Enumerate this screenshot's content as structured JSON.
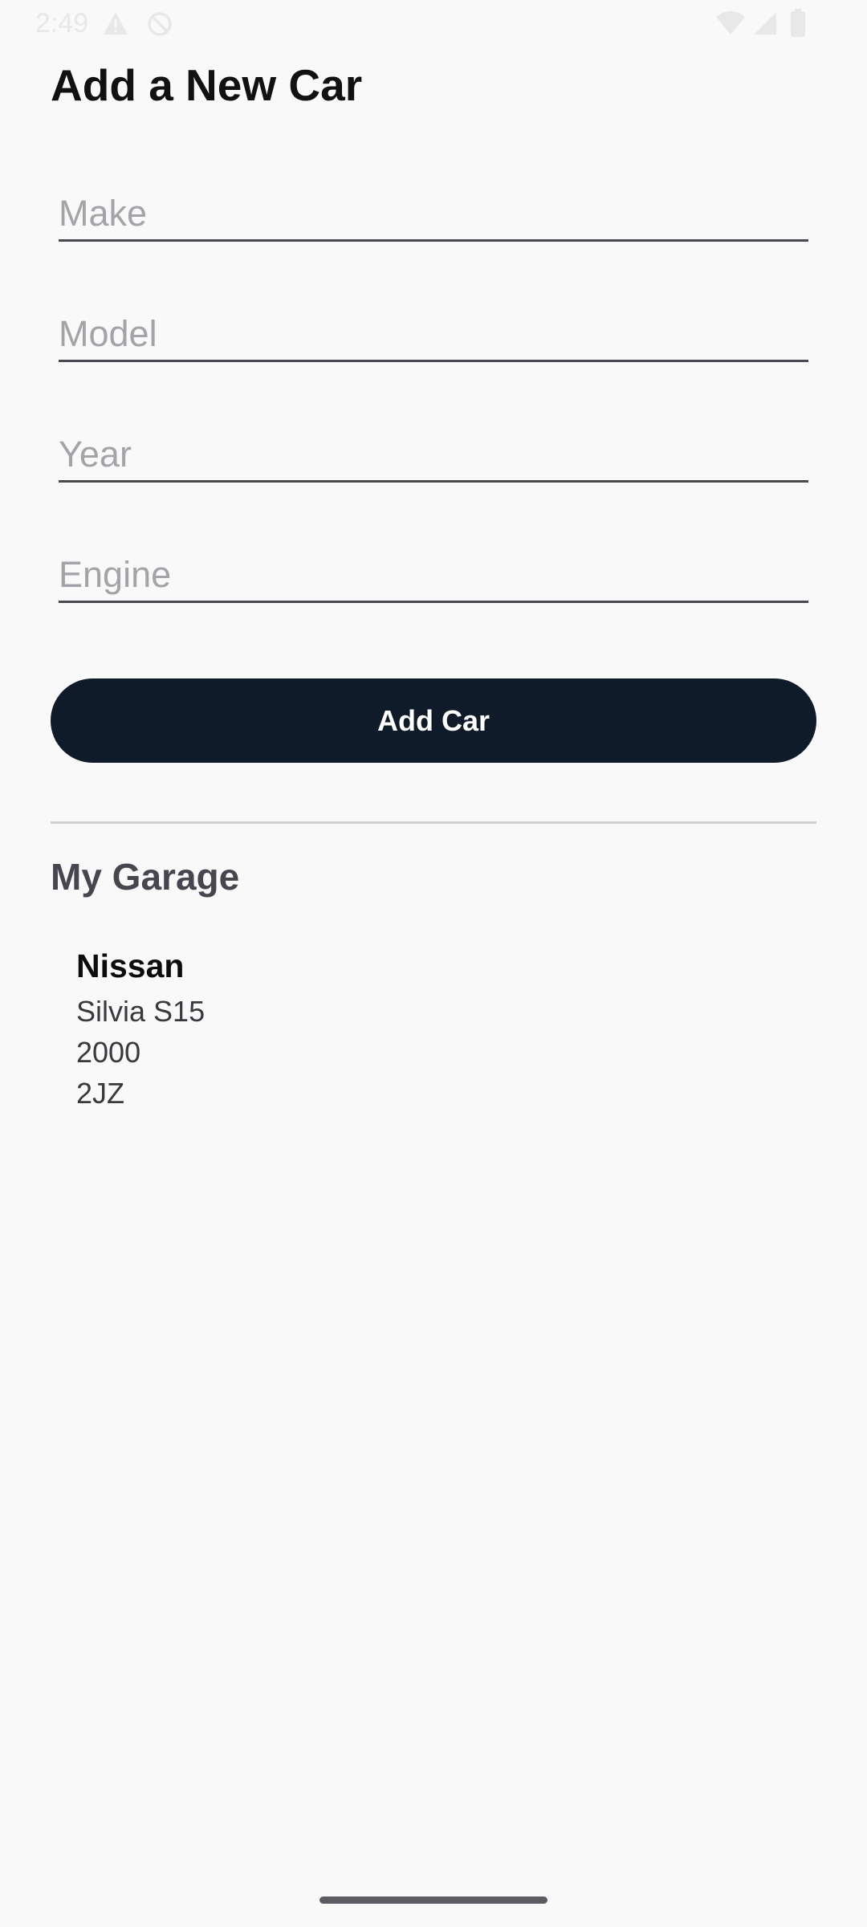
{
  "status_bar": {
    "time": "2:49",
    "icons": [
      "warning-icon",
      "no-disturb-icon",
      "wifi-icon",
      "signal-icon",
      "battery-icon"
    ]
  },
  "page_title": "Add a New Car",
  "form": {
    "fields": [
      {
        "name": "make",
        "placeholder": "Make",
        "value": ""
      },
      {
        "name": "model",
        "placeholder": "Model",
        "value": ""
      },
      {
        "name": "year",
        "placeholder": "Year",
        "value": ""
      },
      {
        "name": "engine",
        "placeholder": "Engine",
        "value": ""
      }
    ],
    "submit_label": "Add Car"
  },
  "garage": {
    "title": "My Garage",
    "cars": [
      {
        "make": "Nissan",
        "model": "Silvia S15",
        "year": "2000",
        "engine": "2JZ"
      }
    ]
  },
  "colors": {
    "background": "#f9f9f9",
    "button": "#101b2a",
    "button_text": "#ffffff",
    "placeholder": "#a4a4a8"
  }
}
